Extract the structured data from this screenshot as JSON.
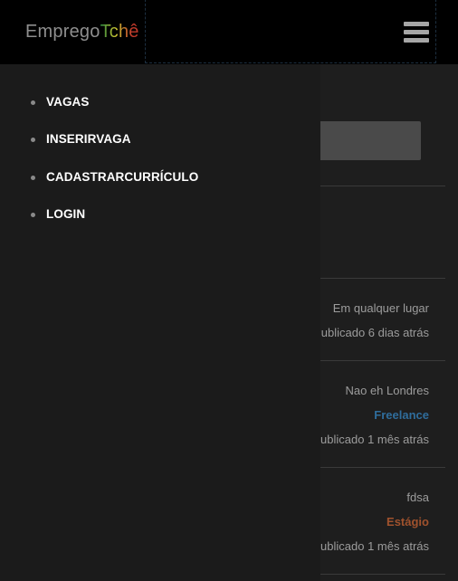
{
  "header": {
    "logo_part1": "Emprego",
    "logo_part2": "Tchê",
    "menu_icon": "hamburger-menu-icon"
  },
  "drawer": {
    "items": [
      {
        "label": "VAGAS"
      },
      {
        "label": "INSERIRVAGA"
      },
      {
        "label": "CADASTRARCURRÍCULO"
      },
      {
        "label": "LOGIN"
      }
    ]
  },
  "listings": [
    {
      "location": "Em qualquer lugar",
      "badge": "",
      "posted": "Publicado 6 dias atrás"
    },
    {
      "location": "Nao eh Londres",
      "badge": "Freelance",
      "posted": "Publicado 1 mês atrás"
    },
    {
      "location": "fdsa",
      "badge": "Estágio",
      "posted": "Publicado 1 mês atrás"
    }
  ],
  "colors": {
    "freelance": "#2f6d9c",
    "estagio": "#a0522d",
    "drawer_bg": "#1b1b1b"
  }
}
